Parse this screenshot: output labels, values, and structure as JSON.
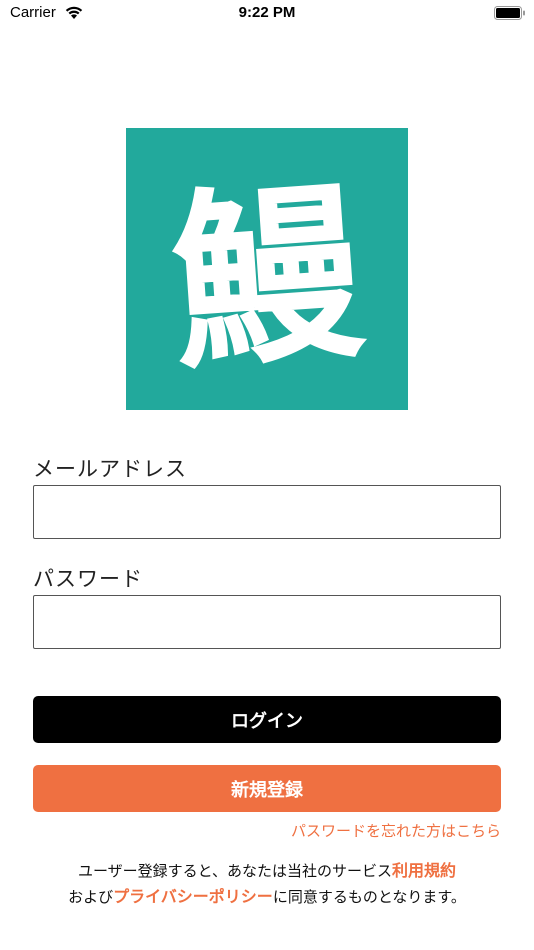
{
  "status_bar": {
    "carrier": "Carrier",
    "time": "9:22 PM"
  },
  "logo": {
    "glyph": "鰻",
    "background": "#22a99c"
  },
  "form": {
    "email_label": "メールアドレス",
    "email_value": "",
    "password_label": "パスワード",
    "password_value": ""
  },
  "buttons": {
    "login": "ログイン",
    "register": "新規登録"
  },
  "forgot_password": "パスワードを忘れた方はこちら",
  "terms": {
    "prefix": "ユーザー登録すると、あなたは当社のサービス",
    "terms_link": "利用規約",
    "middle": "および",
    "privacy_link": "プライバシーポリシー",
    "suffix": "に同意するものとなります。"
  },
  "colors": {
    "accent": "#ef7041",
    "primary_button": "#000000",
    "logo_bg": "#22a99c"
  }
}
